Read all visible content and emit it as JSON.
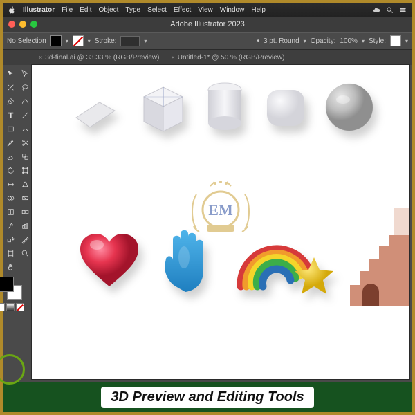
{
  "mac_menu": {
    "app": "Illustrator",
    "items": [
      "File",
      "Edit",
      "Object",
      "Type",
      "Select",
      "Effect",
      "View",
      "Window",
      "Help"
    ]
  },
  "window": {
    "title": "Adobe Illustrator 2023"
  },
  "control_bar": {
    "selection": "No Selection",
    "stroke_label": "Stroke:",
    "stroke_value": "",
    "brush_label": "3 pt. Round",
    "opacity_label": "Opacity:",
    "opacity_value": "100%",
    "style_label": "Style:"
  },
  "tabs": [
    {
      "label": "3d-final.ai @ 33.33 % (RGB/Preview)"
    },
    {
      "label": "Untitled-1* @ 50 % (RGB/Preview)"
    }
  ],
  "tools_left": [
    "selection",
    "direct-select",
    "pen",
    "curvature",
    "type",
    "line",
    "rectangle",
    "paintbrush",
    "shaper",
    "eraser",
    "rotate",
    "scale",
    "width",
    "free-transform",
    "shape-builder",
    "perspective",
    "mesh",
    "gradient",
    "eyedropper",
    "blend",
    "symbol-spray",
    "column-graph",
    "artboard",
    "slice",
    "hand",
    "zoom"
  ],
  "caption": "3D Preview and Editing Tools",
  "colors": {
    "accent_border": "#b08a2a",
    "caption_bg": "#16521f"
  }
}
